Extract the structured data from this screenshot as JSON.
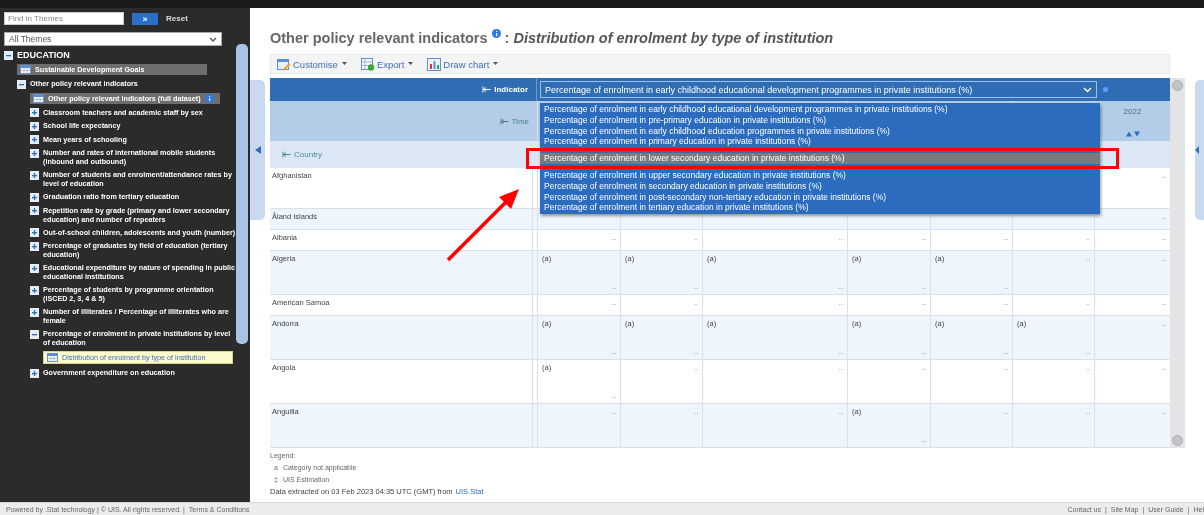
{
  "sidebar": {
    "search": {
      "placeholder": "Find in Themes"
    },
    "search_button": "»",
    "reset": "Reset",
    "theme_select": "All Themes",
    "tree": [
      {
        "label": "EDUCATION",
        "kind": "folder",
        "expanded": true,
        "children": [
          {
            "label": "Sustainable Development Goals",
            "kind": "dataset",
            "highlighted": true,
            "selected": false,
            "info": false
          },
          {
            "label": "Other policy relevant indicators",
            "kind": "folder",
            "expanded": true,
            "children": [
              {
                "label": "Other policy relevant indicators (full dataset)",
                "kind": "dataset",
                "highlighted": true,
                "selected": false,
                "info": true
              },
              {
                "label": "Classroom teachers and academic staff by sex",
                "kind": "folder",
                "expanded": false
              },
              {
                "label": "School life expectancy",
                "kind": "folder",
                "expanded": false
              },
              {
                "label": "Mean years of schooling",
                "kind": "folder",
                "expanded": false
              },
              {
                "label": "Number and rates of international mobile students (inbound and outbound)",
                "kind": "folder",
                "expanded": false
              },
              {
                "label": "Number of students and enrolment/attendance rates by level of education",
                "kind": "folder",
                "expanded": false
              },
              {
                "label": "Graduation ratio from tertiary education",
                "kind": "folder",
                "expanded": false
              },
              {
                "label": "Repetition rate by grade (primary and lower secondary education) and number of repeaters",
                "kind": "folder",
                "expanded": false
              },
              {
                "label": "Out-of-school children, adolescents and youth (number)",
                "kind": "folder",
                "expanded": false
              },
              {
                "label": "Percentage of graduates by field of education (tertiary education)",
                "kind": "folder",
                "expanded": false
              },
              {
                "label": "Educational expenditure by nature of spending in public educational institutions",
                "kind": "folder",
                "expanded": false
              },
              {
                "label": "Percentage of students by programme orientation (ISCED 2, 3, 4 & 5)",
                "kind": "folder",
                "expanded": false
              },
              {
                "label": "Number of illiterates / Percentage of illiterates who are female",
                "kind": "folder",
                "expanded": false
              },
              {
                "label": "Percentage of enrolment in private institutions by level of education",
                "kind": "folder",
                "expanded": true,
                "children": [
                  {
                    "label": "Distribution of enrolment by type of institution",
                    "kind": "dataset",
                    "highlighted": false,
                    "selected": true,
                    "info": false
                  }
                ]
              },
              {
                "label": "Government expenditure on education",
                "kind": "folder",
                "expanded": false
              }
            ]
          }
        ]
      }
    ]
  },
  "title": {
    "main": "Other policy relevant indicators",
    "separator": ":",
    "subtitle": "Distribution of enrolment by type of institution"
  },
  "toolbar": [
    {
      "label": "Customise",
      "kind": "customise"
    },
    {
      "label": "Export",
      "kind": "export"
    },
    {
      "label": "Draw chart",
      "kind": "chart"
    }
  ],
  "table": {
    "indicator": {
      "label": "Indicator",
      "value": "Percentage of enrolment in early childhood educational development programmes in private institutions (%)",
      "open": true,
      "options": [
        {
          "label": "Percentage of enrolment in early childhood educational development programmes in private institutions (%)",
          "highlighted": false
        },
        {
          "label": "Percentage of enrolment in pre-primary education in private institutions (%)",
          "highlighted": false
        },
        {
          "label": "Percentage of enrolment in early childhood education programmes in private institutions (%)",
          "highlighted": false
        },
        {
          "label": "Percentage of enrolment in primary education in private institutions (%)",
          "highlighted": false
        },
        {
          "label": "Percentage of enrolment in lower secondary education in private institutions (%)",
          "highlighted": true
        },
        {
          "label": "Percentage of enrolment in upper secondary education in private institutions (%)",
          "highlighted": false
        },
        {
          "label": "Percentage of enrolment in secondary education in private institutions (%)",
          "highlighted": false
        },
        {
          "label": "Percentage of enrolment in post-secondary non-tertiary education in private institutions (%)",
          "highlighted": false
        },
        {
          "label": "Percentage of enrolment in tertiary education in private institutions (%)",
          "highlighted": false
        }
      ]
    },
    "time_label": "Time",
    "last_year": "2022",
    "country_label": "Country",
    "rows": [
      {
        "country": "Afghanistan",
        "cells": [
          null,
          null,
          null,
          null,
          null,
          null,
          {
            "value": ".."
          }
        ]
      },
      {
        "country": "Åland Islands",
        "cells": [
          null,
          null,
          null,
          null,
          null,
          null,
          {
            "value": ".."
          }
        ]
      },
      {
        "country": "Albania",
        "cells": [
          {
            "value": ".."
          },
          {
            "value": ".."
          },
          {
            "value": ".."
          },
          {
            "value": ".."
          },
          {
            "value": ".."
          },
          {
            "value": ".."
          },
          {
            "value": ".."
          }
        ]
      },
      {
        "country": "Algeria",
        "cells": [
          {
            "flag": "(a)",
            "value": ".."
          },
          {
            "flag": "(a)",
            "value": ".."
          },
          {
            "flag": "(a)",
            "value": ".."
          },
          {
            "flag": "(a)",
            "value": ".."
          },
          {
            "flag": "(a)",
            "value": ".."
          },
          {
            "value": ".."
          },
          {
            "value": ".."
          }
        ]
      },
      {
        "country": "American Samoa",
        "cells": [
          {
            "value": ".."
          },
          {
            "value": ".."
          },
          {
            "value": ".."
          },
          {
            "value": ".."
          },
          {
            "value": ".."
          },
          {
            "value": ".."
          },
          {
            "value": ".."
          }
        ]
      },
      {
        "country": "Andorra",
        "cells": [
          {
            "flag": "(a)",
            "value": ".."
          },
          {
            "flag": "(a)",
            "value": ".."
          },
          {
            "flag": "(a)",
            "value": ".."
          },
          {
            "flag": "(a)",
            "value": ".."
          },
          {
            "flag": "(a)",
            "value": ".."
          },
          {
            "flag": "(a)",
            "value": ".."
          },
          {
            "value": ".."
          }
        ]
      },
      {
        "country": "Angola",
        "cells": [
          {
            "flag": "(a)",
            "value": ".."
          },
          {
            "value": ".."
          },
          {
            "value": ".."
          },
          {
            "value": ".."
          },
          {
            "value": ".."
          },
          {
            "value": ".."
          },
          {
            "value": ".."
          }
        ]
      },
      {
        "country": "Anguilla",
        "cells": [
          {
            "value": ".."
          },
          {
            "value": ".."
          },
          {
            "value": ".."
          },
          {
            "flag": "(a)",
            "value": ".."
          },
          {
            "value": ".."
          },
          {
            "value": ".."
          },
          {
            "value": ".."
          }
        ]
      }
    ]
  },
  "legend": {
    "title": "Legend:",
    "items": [
      {
        "symbol": "a",
        "text": "Category not applicable"
      },
      {
        "symbol": "‡",
        "text": "UIS Estimation"
      }
    ]
  },
  "extraction": {
    "text": "Data extracted on 03 Feb 2023 04:35 UTC (GMT) from",
    "link": "UIS.Stat"
  },
  "footer": {
    "left": "Powered by .Stat technology | © UIS. All rights reserved. |",
    "left_link": "Terms & Conditions",
    "separator": "|",
    "links": [
      "Contact us",
      "Site Map",
      "User Guide",
      "Hel"
    ]
  }
}
